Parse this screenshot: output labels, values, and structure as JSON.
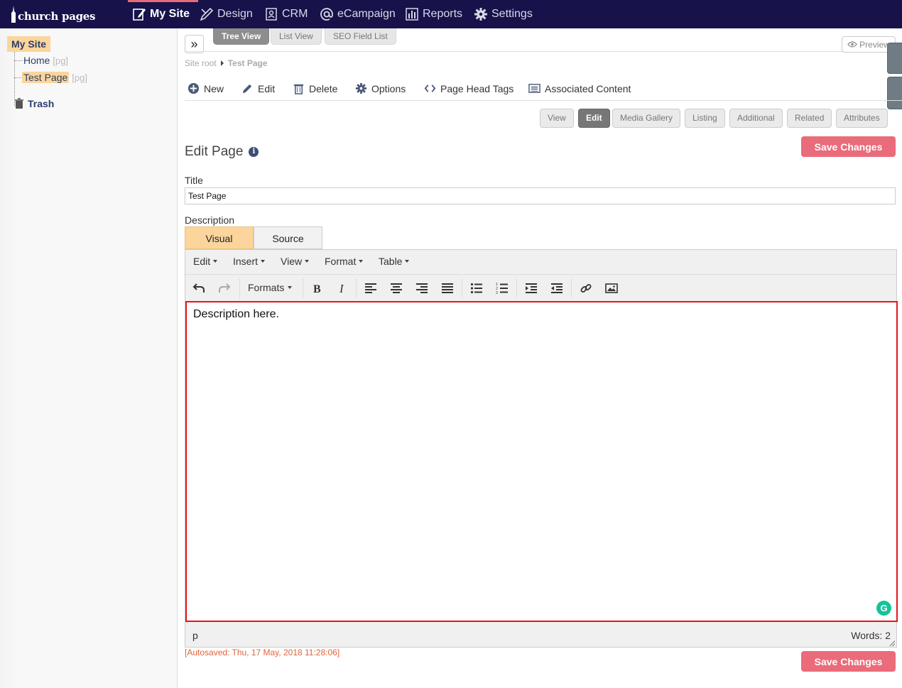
{
  "topnav": {
    "logo": "church pages",
    "items": [
      {
        "label": "My Site",
        "icon": "edit-page-icon"
      },
      {
        "label": "Design",
        "icon": "design-pencil-icon"
      },
      {
        "label": "CRM",
        "icon": "contacts-icon"
      },
      {
        "label": "eCampaign",
        "icon": "at-icon"
      },
      {
        "label": "Reports",
        "icon": "bar-chart-icon"
      },
      {
        "label": "Settings",
        "icon": "gear-icon"
      }
    ],
    "active": "My Site",
    "accent": "#e86a7a",
    "background": "#17124a"
  },
  "sidebar": {
    "root": "My Site",
    "items": [
      {
        "label": "Home",
        "tag": "[pg]"
      },
      {
        "label": "Test Page",
        "tag": "[pg]"
      }
    ],
    "trash": "Trash",
    "selected_color": "#fbd59b"
  },
  "view_tabs": [
    "Tree View",
    "List View",
    "SEO Field List"
  ],
  "active_view_tab": "Tree View",
  "preview_label": "Preview",
  "breadcrumb": {
    "root": "Site root",
    "current": "Test Page"
  },
  "actions": [
    {
      "label": "New",
      "icon": "plus-circle-icon"
    },
    {
      "label": "Edit",
      "icon": "pencil-icon"
    },
    {
      "label": "Delete",
      "icon": "trash-icon"
    },
    {
      "label": "Options",
      "icon": "gear-icon"
    },
    {
      "label": "Page Head Tags",
      "icon": "code-brackets-icon"
    },
    {
      "label": "Associated Content",
      "icon": "list-icon"
    }
  ],
  "sub_tabs": [
    "View",
    "Edit",
    "Media Gallery",
    "Listing",
    "Additional",
    "Related",
    "Attributes"
  ],
  "active_sub_tab": "Edit",
  "save_label": "Save Changes",
  "save_color": "#ea6b7a",
  "page_heading": "Edit Page",
  "form": {
    "title_label": "Title",
    "title_value": "Test Page",
    "description_label": "Description"
  },
  "editor": {
    "mode_tabs": [
      "Visual",
      "Source"
    ],
    "active_mode": "Visual",
    "menus": [
      "Edit",
      "Insert",
      "View",
      "Format",
      "Table"
    ],
    "formats_label": "Formats",
    "content": "Description here.",
    "status_path": "p",
    "word_count": "Words: 2",
    "highlight_color": "#e8141c"
  },
  "autosaved": "[Autosaved: Thu, 17 May, 2018 11:28:06]"
}
